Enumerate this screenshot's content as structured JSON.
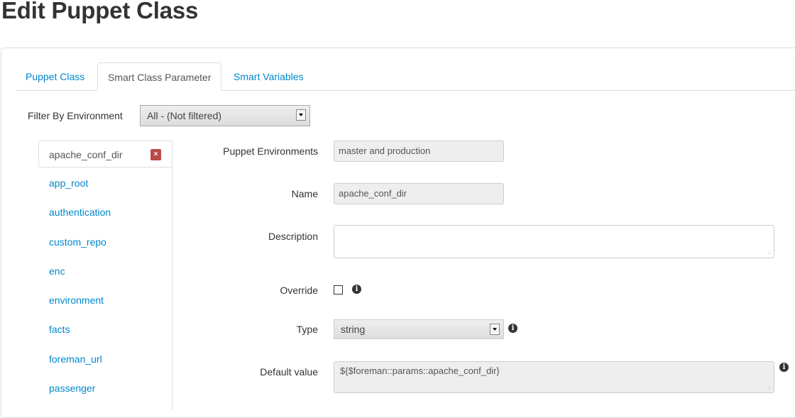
{
  "page": {
    "title": "Edit Puppet Class"
  },
  "tabs": [
    {
      "label": "Puppet Class",
      "active": false
    },
    {
      "label": "Smart Class Parameter",
      "active": true
    },
    {
      "label": "Smart Variables",
      "active": false
    }
  ],
  "filter": {
    "label": "Filter By Environment",
    "selected": "All - (Not filtered)"
  },
  "params": {
    "active": "apache_conf_dir",
    "remove_symbol": "×",
    "items": [
      "app_root",
      "authentication",
      "custom_repo",
      "enc",
      "environment",
      "facts",
      "foreman_url",
      "passenger"
    ]
  },
  "form": {
    "environments": {
      "label": "Puppet Environments",
      "value": "master and production"
    },
    "name": {
      "label": "Name",
      "value": "apache_conf_dir"
    },
    "description": {
      "label": "Description",
      "value": ""
    },
    "override": {
      "label": "Override",
      "checked": false
    },
    "type": {
      "label": "Type",
      "value": "string"
    },
    "default_value": {
      "label": "Default value",
      "value": "${$foreman::params::apache_conf_dir}"
    }
  },
  "icons": {
    "info": "info-circle-icon",
    "resize": "resize-grip-icon"
  },
  "colors": {
    "link": "#0088cc",
    "remove_badge": "#b94a48"
  }
}
